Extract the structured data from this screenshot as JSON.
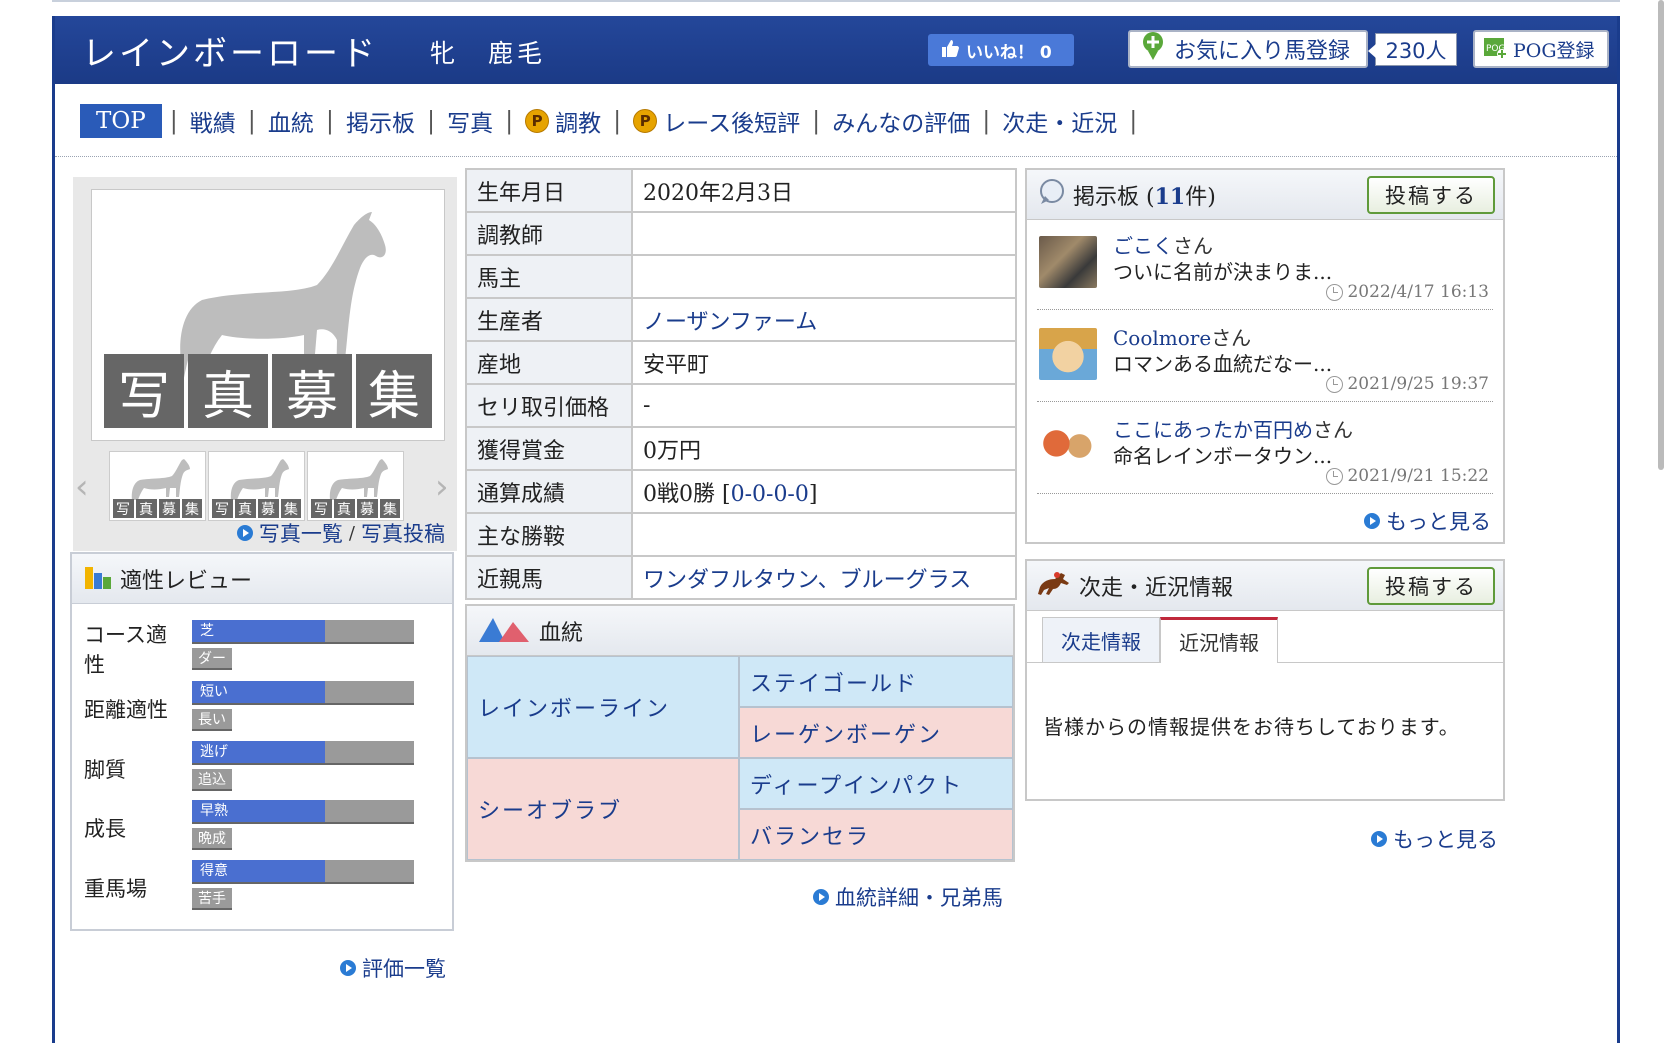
{
  "header": {
    "horse_name": "レインボーロード",
    "horse_sub": "牝　鹿毛",
    "like_label": "いいね！ 0",
    "fav_label": "お気に入り馬登録",
    "fav_count": "230人",
    "pog_label": "POG登録"
  },
  "nav": {
    "top": "TOP",
    "items": [
      "戦績",
      "血統",
      "掲示板",
      "写真",
      "調教",
      "レース後短評",
      "みんなの評価",
      "次走・近況"
    ],
    "premium_badge": "P"
  },
  "photo": {
    "placeholder": [
      "写",
      "真",
      "募",
      "集"
    ],
    "list_link": "写真一覧",
    "sep": "/",
    "post_link": "写真投稿"
  },
  "review": {
    "title": "適性レビュー",
    "rows": [
      {
        "label": "コース適性",
        "top": "芝",
        "bottom": "ダート",
        "value": 0.6
      },
      {
        "label": "距離適性",
        "top": "短い",
        "bottom": "長い",
        "value": 0.6
      },
      {
        "label": "脚質",
        "top": "逃げ",
        "bottom": "追込",
        "value": 0.6
      },
      {
        "label": "成長",
        "top": "早熟",
        "bottom": "晩成",
        "value": 0.6
      },
      {
        "label": "重馬場",
        "top": "得意",
        "bottom": "苦手",
        "value": 0.6
      }
    ],
    "more_link": "評価一覧"
  },
  "info": {
    "birth_label": "生年月日",
    "birth": "2020年2月3日",
    "trainer_label": "調教師",
    "trainer": "",
    "owner_label": "馬主",
    "owner": "",
    "breeder_label": "生産者",
    "breeder": "ノーザンファーム",
    "origin_label": "産地",
    "origin": "安平町",
    "sale_label": "セリ取引価格",
    "sale": "-",
    "prize_label": "獲得賞金",
    "prize": "0万円",
    "record_label": "通算成績",
    "record": "0戦0勝 [",
    "record_link": "0-0-0-0",
    "record_end": "]",
    "wins_label": "主な勝鞍",
    "wins": "",
    "relatives_label": "近親馬",
    "relatives": "ワンダフルタウン、ブルーグラス"
  },
  "pedigree": {
    "title": "血統",
    "sire": "レインボーライン",
    "sire_sire": "ステイゴールド",
    "sire_dam": "レーゲンボーゲン",
    "dam": "シーオブラブ",
    "dam_sire": "ディープインパクト",
    "dam_dam": "バランセラ",
    "detail_link": "血統詳細・兄弟馬"
  },
  "board": {
    "title": "掲示板 (",
    "count": "11",
    "count_suffix": "件)",
    "post_button": "投稿する",
    "posts": [
      {
        "user": "ごこく",
        "san": "さん",
        "text": "ついに名前が決まりま...",
        "time": "2022/4/17 16:13"
      },
      {
        "user": "Coolmore",
        "san": "さん",
        "text": "ロマンある血統だなー...",
        "time": "2021/9/25 19:37"
      },
      {
        "user": "ここにあったか百円め",
        "san": "さん",
        "text": "命名レインボータウン...",
        "time": "2021/9/21 15:22"
      }
    ],
    "more": "もっと見る"
  },
  "next": {
    "title": "次走・近況情報",
    "post_button": "投稿する",
    "tab1": "次走情報",
    "tab2": "近況情報",
    "message": "皆様からの情報提供をお待ちしております。",
    "more": "もっと見る"
  },
  "colors": {
    "header_blue": "#1b3a86",
    "link_blue": "#1a3c8c",
    "pedigree_blue": "#cfe8f7",
    "pedigree_pink": "#f7d9d6",
    "bar_fill": "#4a6fd0"
  }
}
